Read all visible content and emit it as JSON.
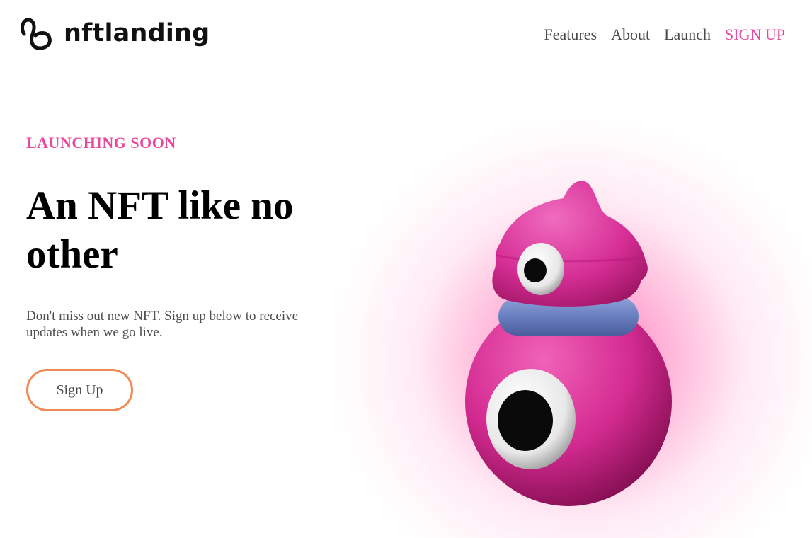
{
  "brand": {
    "name": "nftlanding",
    "icon": "loop-logo-icon"
  },
  "nav": {
    "items": [
      {
        "label": "Features"
      },
      {
        "label": "About"
      },
      {
        "label": "Launch"
      }
    ],
    "signup_label": "SIGN UP"
  },
  "hero": {
    "eyebrow": "LAUNCHING SOON",
    "title_line1": "An NFT like no",
    "title_line2": "other",
    "subtitle": "Don't miss out new NFT. Sign up below to receive updates when we go live.",
    "cta_label": "Sign Up"
  },
  "colors": {
    "accent_pink": "#e8489f",
    "button_border": "#ef8a54",
    "creature_body": "#d42b91",
    "collar": "#6a7fc0"
  },
  "illustration": {
    "icon": "pink-creature-nft-illustration"
  }
}
